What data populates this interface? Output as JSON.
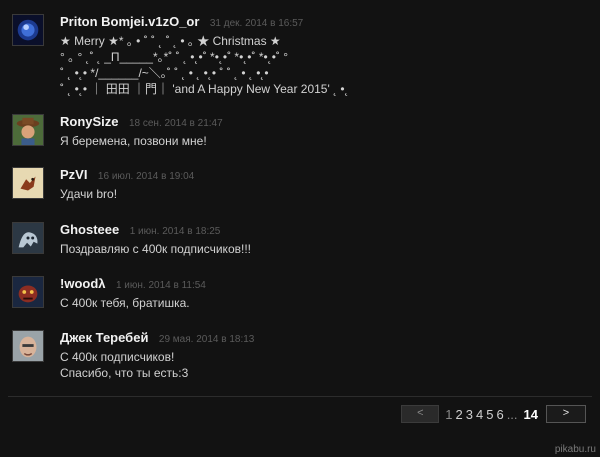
{
  "comments": [
    {
      "author": "Priton Bomjei.v1zO_or",
      "date": "31 дек. 2014 в 16:57",
      "text": "★ Merry ★* ｡ • ˚ ˚ ˛ ˚ ˛ • ｡ ★ Christmas ★\n° ｡ ° ˛˚ ˛ _Π_____*｡*˚ ˚ ˛ •˛•˚ *•˛•˚ *•˛•˚ *•˛•˚ °\n˚ ˛ •˛• */______/~＼｡˚ ˚ ˛ • ˛ •˛• ˚ ˚ ˛ • ˛ •˛•\n˚ ˛ •˛• ｜ 田田 ｜門｜ 'and A Happy New Year 2015' ˛ •˛"
    },
    {
      "author": "RonySize",
      "date": "18 сен. 2014 в 21:47",
      "text": "Я беремена, позвони мне!"
    },
    {
      "author": "PzVI",
      "date": "16 июл. 2014 в 19:04",
      "text": "Удачи bro!"
    },
    {
      "author": "Ghosteee",
      "date": "1 июн. 2014 в 18:25",
      "text": "Поздравляю с 400к подписчиков!!!"
    },
    {
      "author": "!woodλ",
      "date": "1 июн. 2014 в 11:54",
      "text": "С 400к тебя, братишка."
    },
    {
      "author": "Джек Теребей",
      "date": "29 мая. 2014 в 18:13",
      "text": "С 400к подписчиков!\nСпасибо, что ты есть:3"
    }
  ],
  "pagination": {
    "prev_label": "<",
    "pages": [
      "1",
      "2",
      "3",
      "4",
      "5",
      "6"
    ],
    "current": "1",
    "ellipsis": "...",
    "last": "14",
    "next_label": ">"
  },
  "watermark": "pikabu.ru",
  "icons": {
    "avatar_1": "avatar-blue-orb-icon",
    "avatar_2": "avatar-cowboy-icon",
    "avatar_3": "avatar-dragon-icon",
    "avatar_4": "avatar-ghost-icon",
    "avatar_5": "avatar-red-creature-icon",
    "avatar_6": "avatar-man-face-icon"
  }
}
